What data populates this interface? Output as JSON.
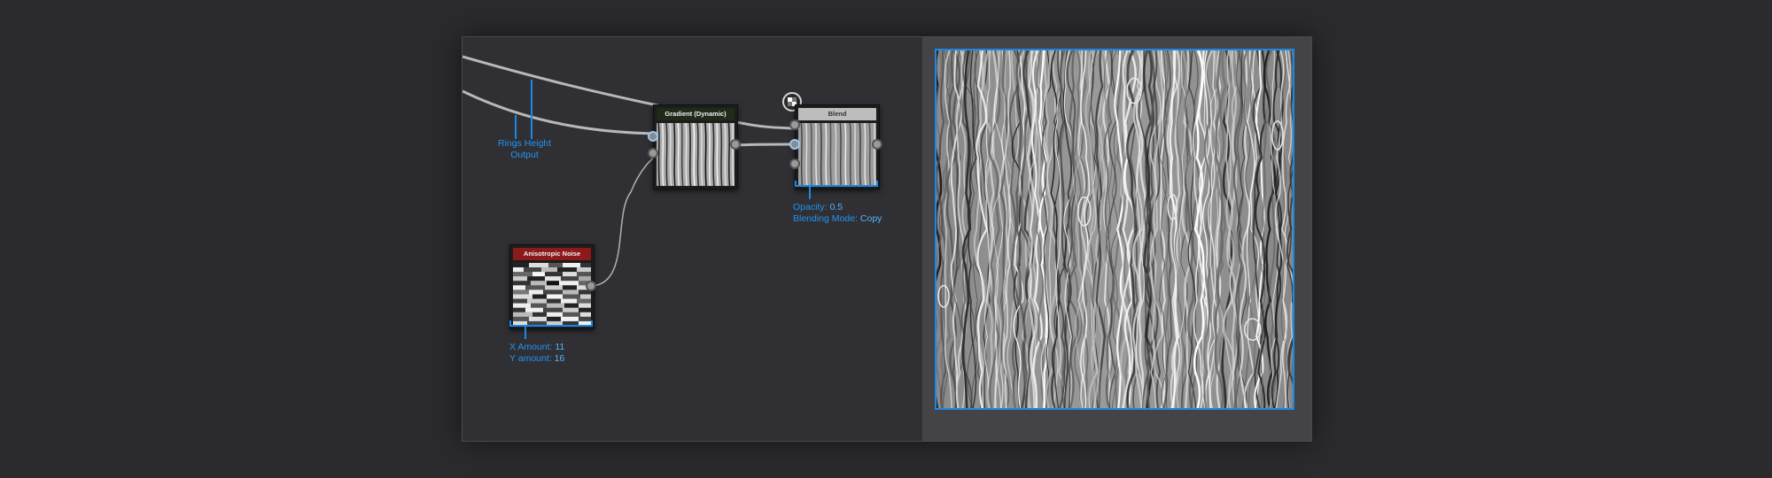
{
  "graph": {
    "annotation_rings": {
      "line1": "Rings Height",
      "line2": "Output"
    },
    "nodes": {
      "gradient": {
        "title": "Gradient (Dynamic)",
        "title_color": "#1f2a18"
      },
      "blend": {
        "title": "Blend",
        "title_color": "#bdbdbd"
      },
      "noise": {
        "title": "Anisotropic Noise",
        "title_color": "#8c1a1a"
      }
    },
    "blend_params": {
      "opacity_label": "Opacity:",
      "opacity_value": "0.5",
      "mode_label": "Blending Mode:",
      "mode_value": "Copy"
    },
    "noise_params": {
      "x_label": "X Amount:",
      "x_value": "11",
      "y_label": "Y amount:",
      "y_value": "16"
    }
  },
  "preview": {
    "accent": "#1c88e6"
  },
  "icons": {
    "toggle": "checker-toggle-icon"
  }
}
